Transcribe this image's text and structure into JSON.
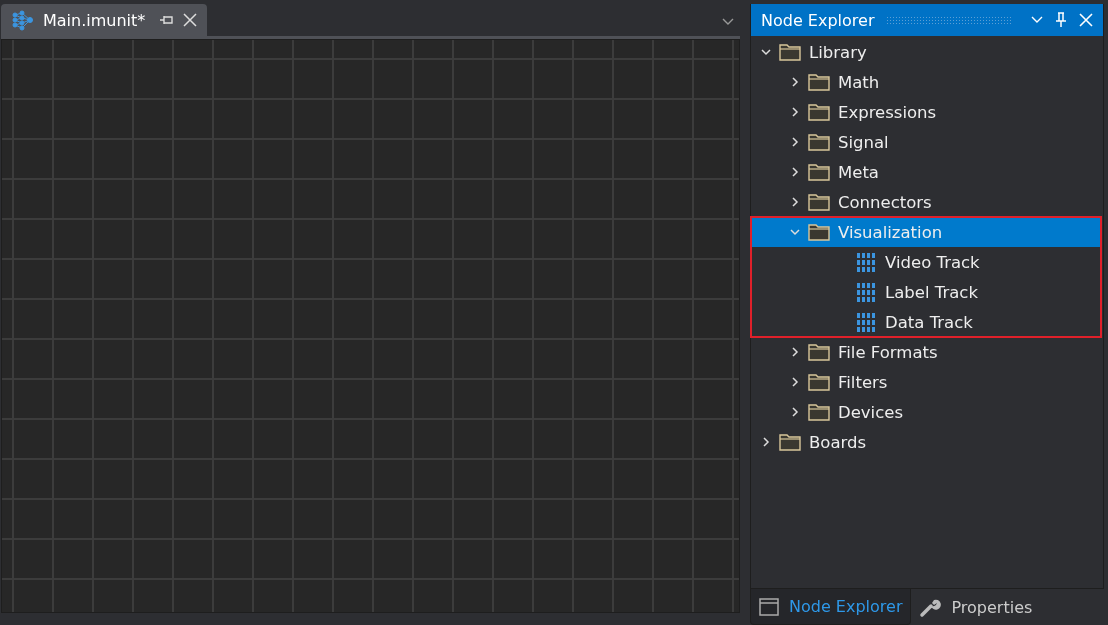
{
  "document_tabs": [
    {
      "label": "Main.imunit*",
      "selected": true
    }
  ],
  "node_explorer": {
    "title": "Node Explorer",
    "tree": [
      {
        "kind": "folder",
        "label": "Library",
        "expanded": true,
        "selected": false,
        "highlighted": false,
        "children": [
          {
            "kind": "folder",
            "label": "Math",
            "expanded": false,
            "selected": false,
            "highlighted": false
          },
          {
            "kind": "folder",
            "label": "Expressions",
            "expanded": false,
            "selected": false,
            "highlighted": false
          },
          {
            "kind": "folder",
            "label": "Signal",
            "expanded": false,
            "selected": false,
            "highlighted": false
          },
          {
            "kind": "folder",
            "label": "Meta",
            "expanded": false,
            "selected": false,
            "highlighted": false
          },
          {
            "kind": "folder",
            "label": "Connectors",
            "expanded": false,
            "selected": false,
            "highlighted": false
          },
          {
            "kind": "folder",
            "label": "Visualization",
            "expanded": true,
            "selected": true,
            "highlighted": true,
            "children": [
              {
                "kind": "node",
                "label": "Video Track",
                "selected": false
              },
              {
                "kind": "node",
                "label": "Label Track",
                "selected": false
              },
              {
                "kind": "node",
                "label": "Data Track",
                "selected": false
              }
            ]
          },
          {
            "kind": "folder",
            "label": "File Formats",
            "expanded": false,
            "selected": false,
            "highlighted": false
          },
          {
            "kind": "folder",
            "label": "Filters",
            "expanded": false,
            "selected": false,
            "highlighted": false
          },
          {
            "kind": "folder",
            "label": "Devices",
            "expanded": false,
            "selected": false,
            "highlighted": false
          }
        ]
      },
      {
        "kind": "folder",
        "label": "Boards",
        "expanded": false,
        "selected": false,
        "highlighted": false
      }
    ]
  },
  "panel_tabs": [
    {
      "label": "Node Explorer",
      "selected": true,
      "kind": "explorer"
    },
    {
      "label": "Properties",
      "selected": false,
      "kind": "properties"
    }
  ]
}
